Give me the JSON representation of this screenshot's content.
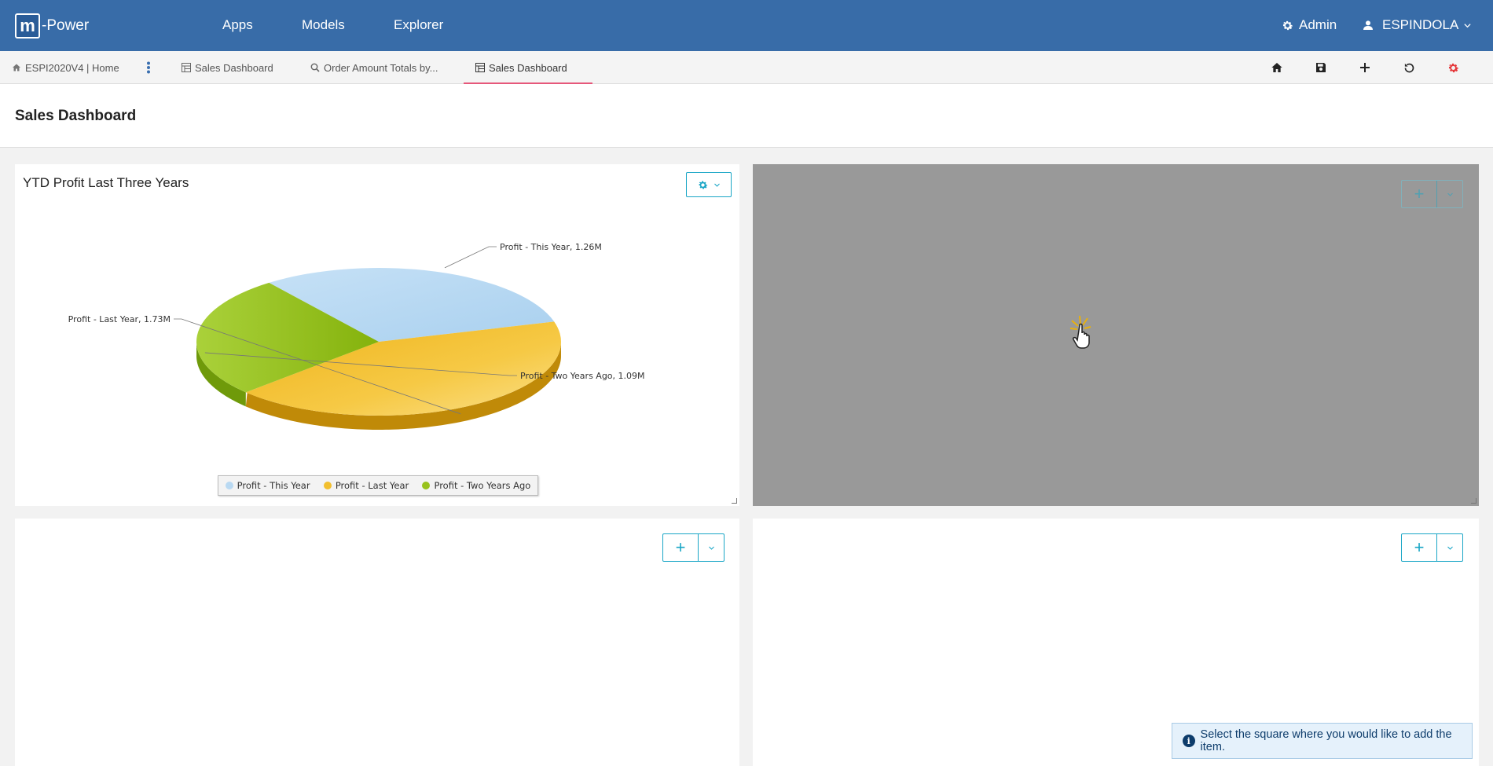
{
  "header": {
    "logo_letter": "m",
    "logo_text": "-Power",
    "nav": [
      "Apps",
      "Models",
      "Explorer"
    ],
    "admin_label": "Admin",
    "user_label": "ESPINDOLA"
  },
  "tabs": {
    "home": "ESPI2020V4 | Home",
    "items": [
      "Sales Dashboard",
      "Order Amount Totals by...",
      "Sales Dashboard"
    ]
  },
  "page": {
    "title": "Sales Dashboard"
  },
  "panels": {
    "top_left_title": "YTD Profit Last Three Years"
  },
  "chart_data": {
    "type": "pie",
    "title": "YTD Profit Last Three Years",
    "slices": [
      {
        "name": "Profit - This Year",
        "value": 1.26,
        "label": "Profit - This Year, 1.26M",
        "color": "#b9d9f2"
      },
      {
        "name": "Profit - Last Year",
        "value": 1.73,
        "label": "Profit - Last Year, 1.73M",
        "color": "#f2bf2e"
      },
      {
        "name": "Profit - Two Years Ago",
        "value": 1.09,
        "label": "Profit - Two Years Ago, 1.09M",
        "color": "#98c21c"
      }
    ],
    "legend_position": "bottom"
  },
  "toast": {
    "message": "Select the square where you would like to add the item."
  },
  "colors": {
    "header": "#386ca8",
    "accent": "#1aa6c6",
    "tab_underline": "#e6577a"
  }
}
